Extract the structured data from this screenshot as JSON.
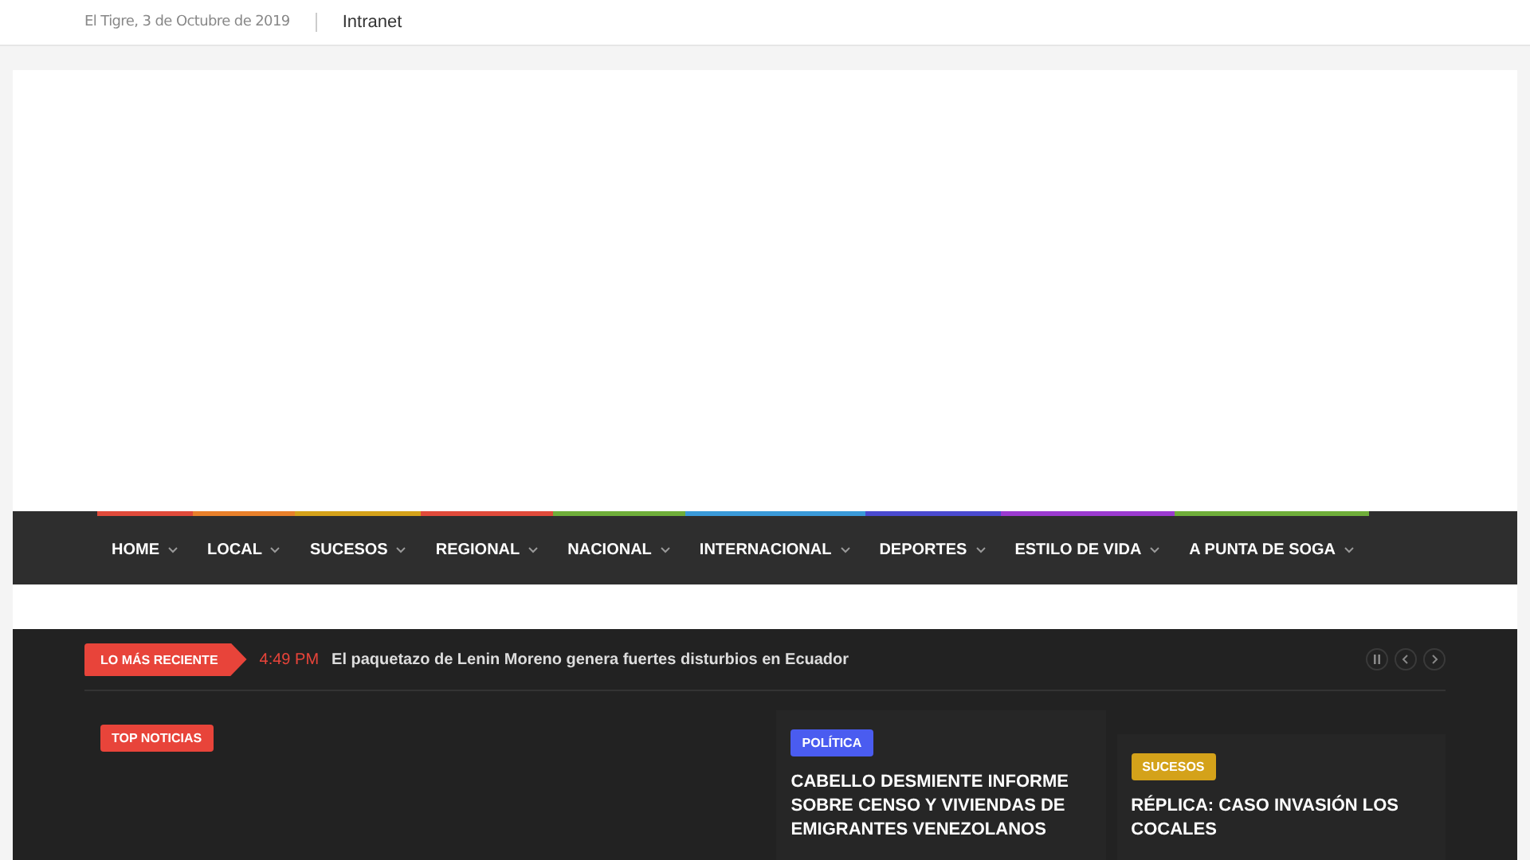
{
  "top_bar": {
    "date": "El Tigre, 3 de Octubre de 2019",
    "link": "Intranet"
  },
  "nav": [
    {
      "label": "HOME",
      "color": "#e04a3a"
    },
    {
      "label": "LOCAL",
      "color": "#e8802a"
    },
    {
      "label": "SUCESOS",
      "color": "#d4a21a"
    },
    {
      "label": "REGIONAL",
      "color": "#e04a3a"
    },
    {
      "label": "NACIONAL",
      "color": "#6fae3a"
    },
    {
      "label": "INTERNACIONAL",
      "color": "#3a9ad9"
    },
    {
      "label": "DEPORTES",
      "color": "#4a4acf"
    },
    {
      "label": "ESTILO DE VIDA",
      "color": "#9b3acf"
    },
    {
      "label": "A PUNTA DE SOGA",
      "color": "#6fae3a"
    }
  ],
  "ticker": {
    "label": "LO MÁS RECIENTE",
    "time": "4:49 PM",
    "headline": "El paquetazo de Lenin Moreno genera fuertes disturbios en Ecuador"
  },
  "featured": {
    "badge": "TOP NOTICIAS"
  },
  "cards": [
    {
      "category": "POLÍTICA",
      "color": "#4a5cf0",
      "title": "CABELLO DESMIENTE INFORME SOBRE CENSO Y VIVIENDAS DE EMIGRANTES VENEZOLANOS"
    },
    {
      "category": "SUCESOS",
      "color": "#d4a21a",
      "title": "RÉPLICA: CASO INVASIÓN LOS COCALES"
    }
  ]
}
